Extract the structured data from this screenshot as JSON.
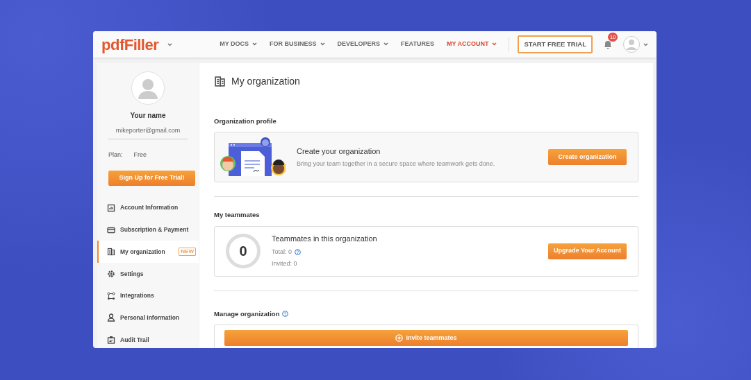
{
  "header": {
    "logo": "pdfFiller",
    "nav": [
      {
        "label": "MY DOCS",
        "selected": false,
        "dropdown": true
      },
      {
        "label": "FOR BUSINESS",
        "selected": false,
        "dropdown": true
      },
      {
        "label": "DEVELOPERS",
        "selected": false,
        "dropdown": true
      },
      {
        "label": "FEATURES",
        "selected": false,
        "dropdown": false
      },
      {
        "label": "MY ACCOUNT",
        "selected": true,
        "dropdown": true
      }
    ],
    "trial_button": "START FREE TRIAL",
    "notifications": "10"
  },
  "sidebar": {
    "name": "Your name",
    "email": "mikeporter@gmail.com",
    "plan_label": "Plan:",
    "plan": "Free",
    "signup_button": "Sign Up for Free Trial!",
    "items": [
      {
        "label": "Account Information",
        "selected": false
      },
      {
        "label": "Subscription & Payment",
        "selected": false
      },
      {
        "label": "My organization",
        "selected": true,
        "badge": "NEW"
      },
      {
        "label": "Settings",
        "selected": false
      },
      {
        "label": "Integrations",
        "selected": false
      },
      {
        "label": "Personal Information",
        "selected": false
      },
      {
        "label": "Audit Trail",
        "selected": false
      }
    ]
  },
  "main": {
    "title": "My organization",
    "profile": {
      "heading": "Organization profile",
      "title": "Create your organization",
      "text": "Bring your team together in a secure space where teamwork gets done.",
      "button": "Create organization"
    },
    "teammates": {
      "heading": "My teammates",
      "count": "0",
      "title": "Teammates in this organization",
      "total": "Total: 0",
      "invited": "Invited: 0",
      "button": "Upgrade Your Account"
    },
    "manage": {
      "heading": "Manage organization",
      "button": "Invite teammates"
    }
  }
}
